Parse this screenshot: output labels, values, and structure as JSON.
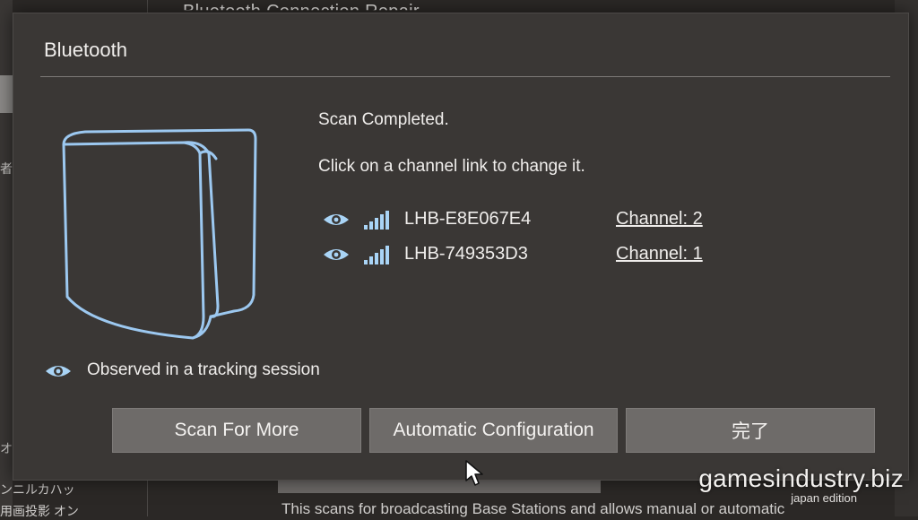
{
  "background": {
    "top_title": "Bluetooth Connection Repair",
    "bottom_text": "This scans for broadcasting Base Stations and allows manual or automatic",
    "left_fragments": [
      "者",
      "オ",
      "ンニルカハッ",
      "用画投影 オン"
    ]
  },
  "dialog": {
    "title": "Bluetooth",
    "status": "Scan Completed.",
    "instruction": "Click on a channel link to change it.",
    "devices": [
      {
        "name": "LHB-E8E067E4",
        "channel": "Channel: 2"
      },
      {
        "name": "LHB-749353D3",
        "channel": "Channel: 1"
      }
    ],
    "legend": "Observed in a tracking session",
    "buttons": {
      "scan_more": "Scan For More",
      "auto_config": "Automatic Configuration",
      "done": "完了"
    }
  },
  "watermark": {
    "main": "gamesindustry.biz",
    "sub": "japan edition"
  },
  "icons": {
    "eye": "eye-icon",
    "signal": "signal-strength-icon",
    "cursor": "mouse-cursor-icon"
  },
  "colors": {
    "dialog_bg": "#3a3735",
    "button_bg": "#6e6b69",
    "accent_blue": "#9cc8f0"
  }
}
